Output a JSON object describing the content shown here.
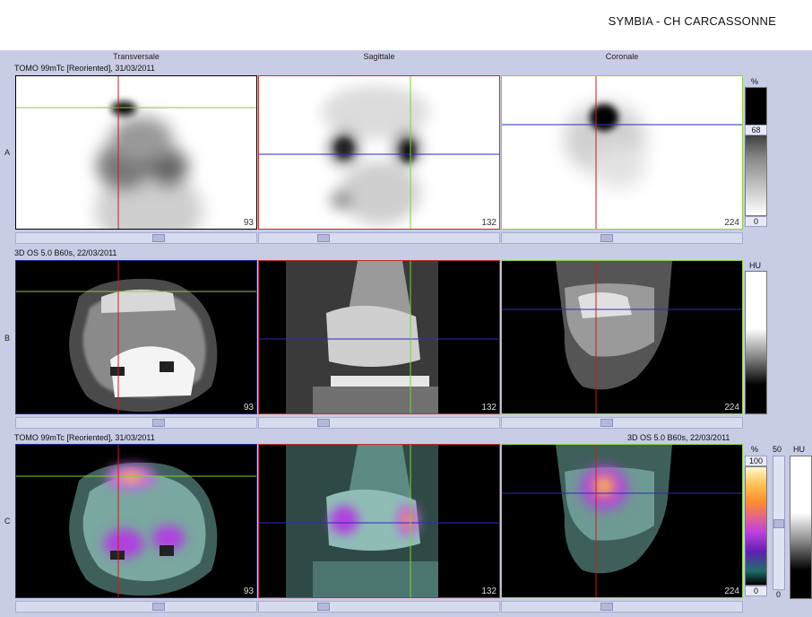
{
  "header": {
    "title": "SYMBIA - CH CARCASSONNE"
  },
  "columns": {
    "transversale": "Transversale",
    "sagittale": "Sagittale",
    "coronale": "Coronale"
  },
  "rows": {
    "a": {
      "letter": "A",
      "info": "TOMO 99mTc [Reoriented], 31/03/2011"
    },
    "b": {
      "letter": "B",
      "info": "3D  OS  5.0  B60s, 22/03/2011"
    },
    "c": {
      "letter": "C",
      "info_left": "TOMO 99mTc [Reoriented], 31/03/2011",
      "info_right": "3D  OS  5.0  B60s, 22/03/2011"
    }
  },
  "slices": {
    "transversale": "93",
    "sagittale": "132",
    "coronale": "224"
  },
  "colorbars": {
    "a": {
      "unit": "%",
      "level": "68",
      "min": "0"
    },
    "b": {
      "unit": "HU"
    },
    "c": {
      "unit": "%",
      "max": "100",
      "min": "0",
      "fusion": "50",
      "ct_unit": "HU"
    }
  },
  "colors": {
    "background": "#c8cce4",
    "transversale_frame": "#000000",
    "sagittale_frame": "#c0302a",
    "coronale_frame": "#8fd04a",
    "fused_frame": "#1a2b8a"
  }
}
